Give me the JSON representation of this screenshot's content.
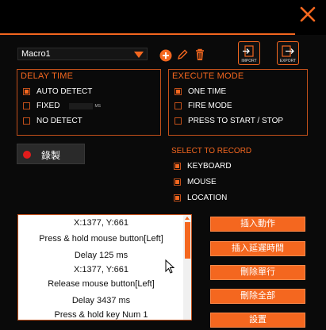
{
  "macro": {
    "selected": "Macro1"
  },
  "toolbar": {
    "import_label": "IMPORT",
    "export_label": "EXPORT"
  },
  "delay_time": {
    "title": "DELAY TIME",
    "options": [
      {
        "label": "AUTO DETECT",
        "checked": true
      },
      {
        "label": "FIXED",
        "checked": false
      },
      {
        "label": "NO DETECT",
        "checked": false
      }
    ],
    "fixed_unit": "MS"
  },
  "execute_mode": {
    "title": "EXECUTE MODE",
    "options": [
      {
        "label": "ONE TIME",
        "checked": true
      },
      {
        "label": "FIRE MODE",
        "checked": false
      },
      {
        "label": "PRESS TO START / STOP",
        "checked": false
      }
    ]
  },
  "record": {
    "label": "錄製"
  },
  "select_to_record": {
    "title": "SELECT TO RECORD",
    "options": [
      {
        "label": "KEYBOARD",
        "checked": true
      },
      {
        "label": "MOUSE",
        "checked": true
      },
      {
        "label": "LOCATION",
        "checked": true
      }
    ]
  },
  "event_list": [
    "X:1377, Y:661",
    "Press & hold mouse button[Left]",
    "Delay 125 ms",
    "X:1377, Y:661",
    "Release mouse button[Left]",
    "Delay 3437 ms",
    "Press & hold key Num 1"
  ],
  "actions": {
    "insert_action": "插入動作",
    "insert_delay": "插入延遲時間",
    "delete_row": "刪除單行",
    "delete_all": "刪除全部",
    "settings": "設置"
  },
  "colors": {
    "accent": "#f4671f",
    "background": "#0a0a0a",
    "record_dot": "#e21c1c"
  }
}
